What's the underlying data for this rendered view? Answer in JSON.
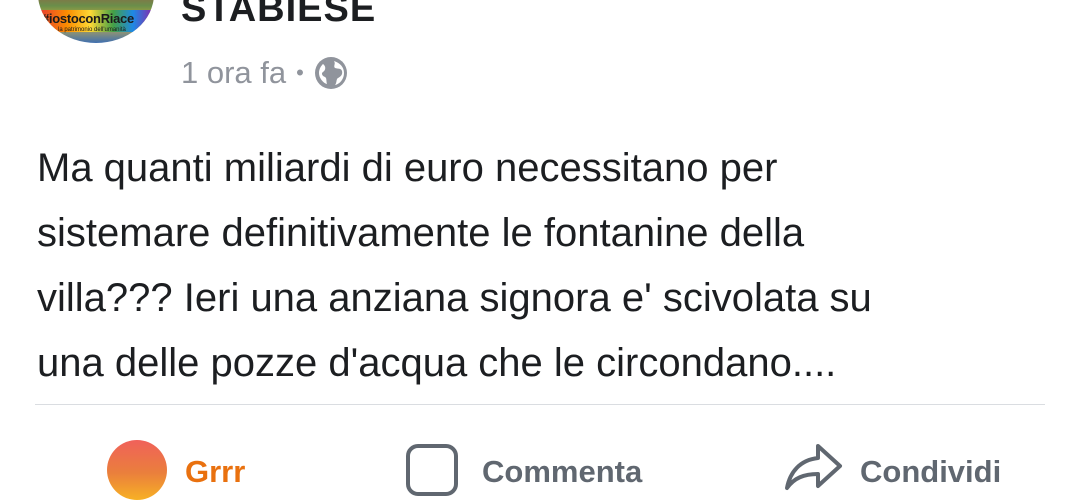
{
  "post": {
    "page_name": "STABIESE",
    "avatar": {
      "text": "#iostoconRiace",
      "subtext": "la patrimonio dell'umanità",
      "colors": [
        "#e53935",
        "#fb8c00",
        "#fdd835",
        "#43a047",
        "#1e88e5",
        "#8e24aa"
      ]
    },
    "timestamp": "1 ora fa",
    "separator": "•",
    "privacy_icon": "globe-icon",
    "body_lines": [
      "Ma quanti miliardi di euro necessitano per",
      "sistemare definitivamente le fontanine della",
      "villa??? Ieri una anziana signora e' scivolata su",
      "una delle pozze d'acqua che le circondano...."
    ]
  },
  "actions": {
    "reaction": {
      "label": "Grrr",
      "icon": "angry-reaction-icon",
      "color": "#e9710f"
    },
    "comment": {
      "label": "Commenta",
      "icon": "comment-icon"
    },
    "share": {
      "label": "Condividi",
      "icon": "share-icon"
    }
  },
  "colors": {
    "text_primary": "#1c1e21",
    "text_secondary": "#90949c",
    "action_text": "#606770",
    "divider": "#dadde1"
  }
}
